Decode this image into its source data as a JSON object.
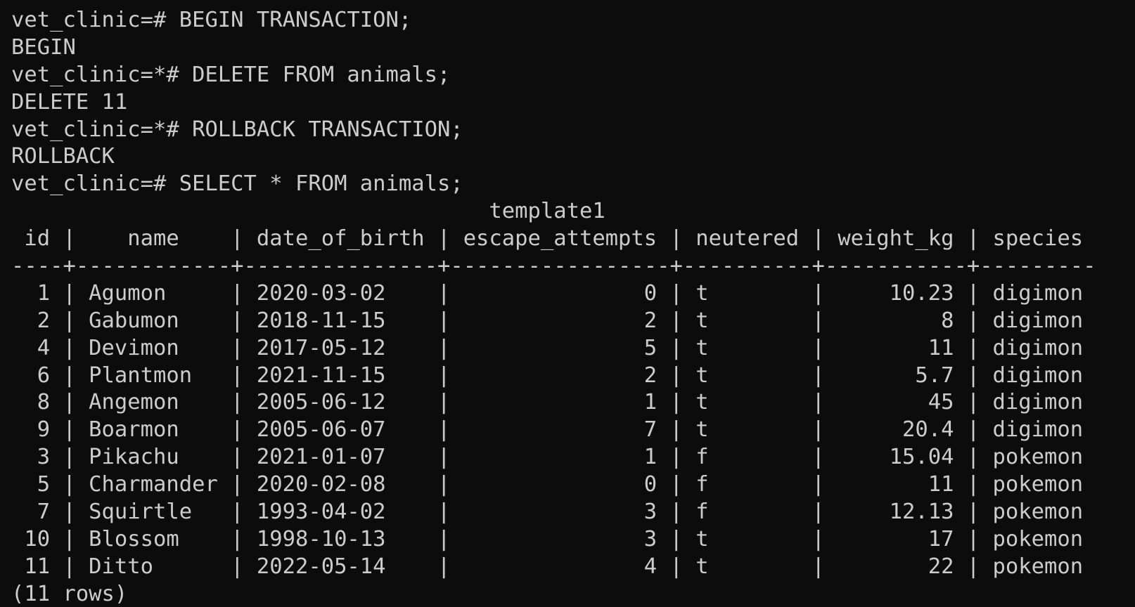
{
  "session": [
    "vet_clinic=# BEGIN TRANSACTION;",
    "BEGIN",
    "vet_clinic=*# DELETE FROM animals;",
    "DELETE 11",
    "vet_clinic=*# ROLLBACK TRANSACTION;",
    "ROLLBACK",
    "vet_clinic=# SELECT * FROM animals;"
  ],
  "result": {
    "title": "                                     template1",
    "header": " id |    name    | date_of_birth | escape_attempts | neutered | weight_kg | species",
    "separator": "----+------------+---------------+-----------------+----------+-----------+---------",
    "rows": [
      "  1 | Agumon     | 2020-03-02    |               0 | t        |     10.23 | digimon",
      "  2 | Gabumon    | 2018-11-15    |               2 | t        |         8 | digimon",
      "  4 | Devimon    | 2017-05-12    |               5 | t        |        11 | digimon",
      "  6 | Plantmon   | 2021-11-15    |               2 | t        |       5.7 | digimon",
      "  8 | Angemon    | 2005-06-12    |               1 | t        |        45 | digimon",
      "  9 | Boarmon    | 2005-06-07    |               7 | t        |      20.4 | digimon",
      "  3 | Pikachu    | 2021-01-07    |               1 | f        |     15.04 | pokemon",
      "  5 | Charmander | 2020-02-08    |               0 | f        |        11 | pokemon",
      "  7 | Squirtle   | 1993-04-02    |               3 | f        |     12.13 | pokemon",
      " 10 | Blossom    | 1998-10-13    |               3 | t        |        17 | pokemon",
      " 11 | Ditto      | 2022-05-14    |               4 | t        |        22 | pokemon"
    ],
    "footer": "(11 rows)"
  },
  "colors": {
    "background": "#0c0c0c",
    "foreground": "#cccccc"
  }
}
